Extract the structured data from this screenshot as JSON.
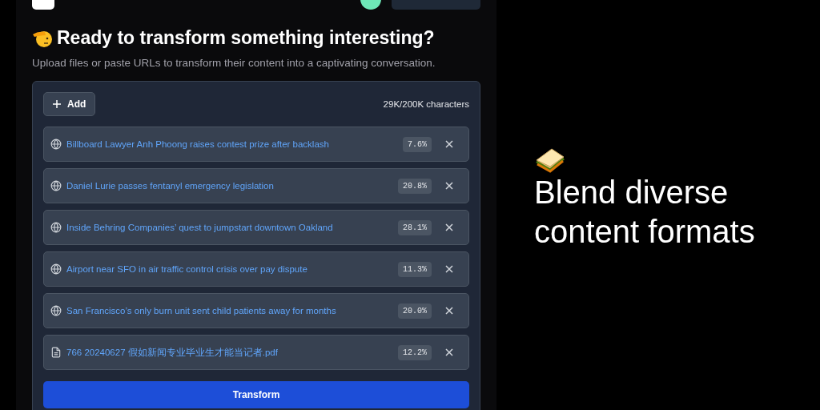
{
  "heading": "Ready to transform something interesting?",
  "subheading": "Upload files or paste URLs to transform their content into a captivating conversation.",
  "add_button": "Add",
  "character_count": "29K/200K characters",
  "sources": [
    {
      "kind": "url",
      "title": "Billboard Lawyer Anh Phoong raises contest prize after backlash",
      "share": "7.6%"
    },
    {
      "kind": "url",
      "title": "Daniel Lurie passes fentanyl emergency legislation",
      "share": "20.8%"
    },
    {
      "kind": "url",
      "title": "Inside Behring Companies’ quest to jumpstart downtown Oakland",
      "share": "28.1%"
    },
    {
      "kind": "url",
      "title": "Airport near SFO in air traffic control crisis over pay dispute",
      "share": "11.3%"
    },
    {
      "kind": "url",
      "title": "San Francisco’s only burn unit sent child patients away for months",
      "share": "20.0%"
    },
    {
      "kind": "file",
      "title": "766 20240627 假如新闻专业毕业生才能当记者.pdf",
      "share": "12.2%"
    }
  ],
  "transform_button": "Transform",
  "tagline": "Blend diverse content formats"
}
